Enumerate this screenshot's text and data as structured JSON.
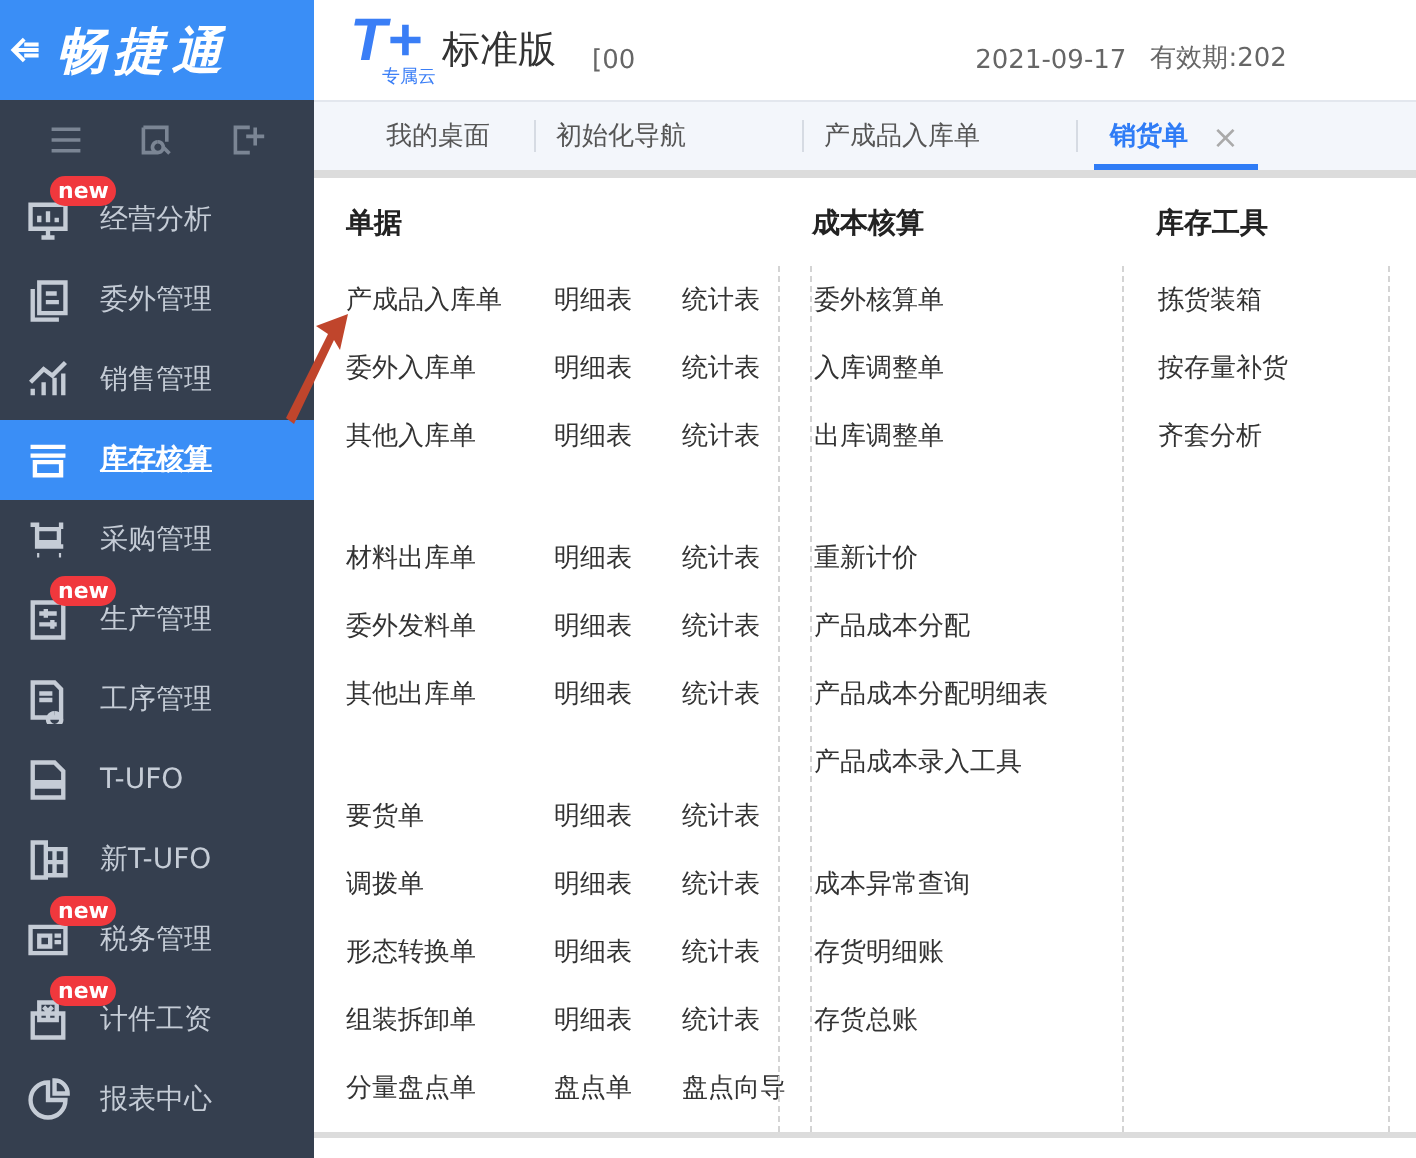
{
  "sidebar": {
    "brand": "畅捷通",
    "items": [
      {
        "label": "经营分析",
        "badge": "new",
        "selected": false
      },
      {
        "label": "委外管理",
        "selected": false
      },
      {
        "label": "销售管理",
        "selected": false
      },
      {
        "label": "库存核算",
        "selected": true
      },
      {
        "label": "采购管理",
        "selected": false
      },
      {
        "label": "生产管理",
        "badge": "new",
        "selected": false
      },
      {
        "label": "工序管理",
        "selected": false
      },
      {
        "label": "T-UFO",
        "selected": false
      },
      {
        "label": "新T-UFO",
        "selected": false
      },
      {
        "label": "税务管理",
        "badge": "new",
        "selected": false
      },
      {
        "label": "计件工资",
        "badge": "new",
        "selected": false
      },
      {
        "label": "报表中心",
        "selected": false
      }
    ]
  },
  "header": {
    "logo_mark": "T+",
    "logo_sub": "专属云",
    "edition": "标准版",
    "company": "[00",
    "date": "2021-09-17",
    "validity": "有效期:202"
  },
  "tabs": [
    {
      "label": "我的桌面",
      "selected": false
    },
    {
      "label": "初始化导航",
      "selected": false
    },
    {
      "label": "产成品入库单",
      "selected": false
    },
    {
      "label": "销货单",
      "selected": true,
      "close": "×"
    }
  ],
  "sections": [
    {
      "title": "单据",
      "groups": [
        [
          [
            "产成品入库单",
            "明细表",
            "统计表"
          ],
          [
            "委外入库单",
            "明细表",
            "统计表"
          ],
          [
            "其他入库单",
            "明细表",
            "统计表"
          ]
        ],
        [
          [
            "材料出库单",
            "明细表",
            "统计表"
          ],
          [
            "委外发料单",
            "明细表",
            "统计表"
          ],
          [
            "其他出库单",
            "明细表",
            "统计表"
          ]
        ],
        [
          [
            "要货单",
            "明细表",
            "统计表"
          ],
          [
            "调拨单",
            "明细表",
            "统计表"
          ],
          [
            "形态转换单",
            "明细表",
            "统计表"
          ],
          [
            "组装拆卸单",
            "明细表",
            "统计表"
          ],
          [
            "分量盘点单",
            "盘点单",
            "盘点向导"
          ]
        ]
      ]
    },
    {
      "title": "成本核算",
      "groups": [
        [
          [
            "委外核算单"
          ],
          [
            "入库调整单"
          ],
          [
            "出库调整单"
          ]
        ],
        [
          [
            "重新计价"
          ],
          [
            "产品成本分配"
          ],
          [
            "产品成本分配明细表"
          ],
          [
            "产品成本录入工具"
          ]
        ],
        [
          [
            "成本异常查询"
          ],
          [
            "存货明细账"
          ],
          [
            "存货总账"
          ]
        ]
      ]
    },
    {
      "title": "库存工具",
      "groups": [
        [
          [
            "拣货装箱"
          ],
          [
            "按存量补货"
          ],
          [
            "齐套分析"
          ]
        ]
      ]
    }
  ]
}
